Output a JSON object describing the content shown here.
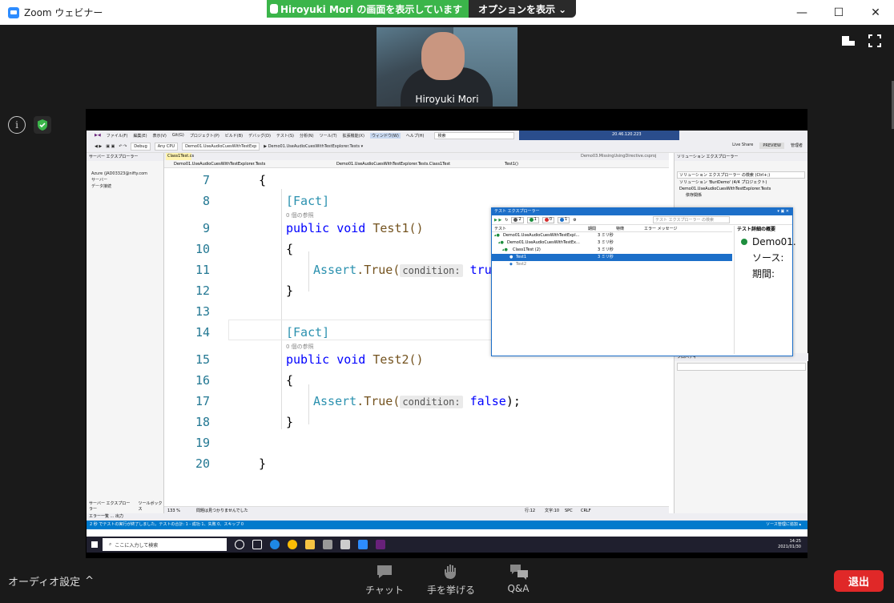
{
  "window": {
    "title": "Zoom ウェビナー",
    "minimize": "—",
    "maximize": "☐",
    "close": "✕"
  },
  "share_banner": {
    "text": "Hiroyuki  Mori の画面を表示しています",
    "options": "オプションを表示 ⌄"
  },
  "video": {
    "participant_name": "Hiroyuki Mori"
  },
  "vs": {
    "menu": [
      "ファイル(F)",
      "編集(E)",
      "表示(V)",
      "Git(G)",
      "プロジェクト(P)",
      "ビルド(B)",
      "デバッグ(D)",
      "テスト(S)",
      "分析(N)",
      "ツール(T)",
      "拡張機能(X)"
    ],
    "menu_highlight": "ウィンドウ(W)",
    "menu_help": "ヘルプ(H)",
    "search": "検索",
    "remote_ip": "20.46.120.223",
    "toolbar": {
      "config": "Debug",
      "platform": "Any CPU",
      "project": "Demo01.UseAudioCuesWithTestExp",
      "run_target": "▶ Demo01.UseAudioCuesWithTestExplorer.Tests ▾",
      "live_share": "Live Share",
      "preview": "PREVIEW",
      "admin": "管理者"
    },
    "server_explorer": {
      "title": "サーバー エクスプローラー",
      "items": [
        "Azure (JAD03323@nifty.com",
        "サーバー",
        "データ接続"
      ],
      "footer": [
        "サーバー エクスプローラー",
        "ツールボックス"
      ]
    },
    "editor": {
      "tab": "Class1Test.cs",
      "tab2": "Demo03.MissingUsingDirective.csproj",
      "nav_project": "Demo01.UseAudioCuesWithTestExplorer.Tests",
      "nav_class": "Demo01.UseAudioCuesWithTestExplorer.Tests.Class1Test",
      "nav_member": "Test1()",
      "refs": "0 個の参照",
      "param_hint": "condition:",
      "lines": [
        {
          "n": "7"
        },
        {
          "n": "8"
        },
        {
          "n": "9"
        },
        {
          "n": "10"
        },
        {
          "n": "11"
        },
        {
          "n": "12"
        },
        {
          "n": "13"
        },
        {
          "n": "14"
        },
        {
          "n": "15"
        },
        {
          "n": "16"
        },
        {
          "n": "17"
        },
        {
          "n": "18"
        },
        {
          "n": "19"
        },
        {
          "n": "20"
        }
      ],
      "code": {
        "open_brace": "{",
        "close_brace": "}",
        "attr": "[Fact]",
        "kw_public": "public",
        "kw_void": "void",
        "test1": "Test1()",
        "test2": "Test2()",
        "assert": "Assert",
        "true_call": ".True(",
        "val_true": "true",
        "val_false": "false",
        "end": ");"
      },
      "status": {
        "zoom": "133 %",
        "issues": "問題は見つかりませんでした",
        "position": "行:12",
        "char": "文字:10",
        "spc": "SPC",
        "crlf": "CRLF"
      }
    },
    "output_tabs": "エラー一覧 ... 出力",
    "statusbar": "2 秒 でテストの実行が終了しました。テストの合計: 1 - 成功 1、失敗 0、スキップ 0",
    "statusbar_right": "ソース管理に追加 ▴",
    "solution": {
      "title": "ソリューション エクスプローラー",
      "search": "ソリューション エクスプローラー の検索 (Ctrl+;)",
      "items": [
        "ソリューション 'BuriDemo' (4/4 プロジェクト)",
        "Demo01.UseAudioCuesWithTestExplorer.Tests",
        "依存関係"
      ],
      "properties": "プロパティ"
    },
    "test_explorer": {
      "title": "テスト エクスプローラー",
      "counts": {
        "total": "2",
        "passed": "1",
        "failed": "0",
        "info": "1"
      },
      "search": "テスト エクスプローラー の検索",
      "headers": [
        "テスト",
        "期間",
        "特徴",
        "エラー メッセージ"
      ],
      "rows": [
        {
          "name": "Demo01.UseAudioCuesWithTestExpl...",
          "dur": "3 ミリ秒"
        },
        {
          "name": "Demo01.UseAudioCuesWithTestEx...",
          "dur": "3 ミリ秒"
        },
        {
          "name": "Class1Test (2)",
          "dur": "3 ミリ秒"
        },
        {
          "name": "Test1",
          "dur": "3 ミリ秒"
        },
        {
          "name": "Test2",
          "dur": ""
        }
      ],
      "detail_title": "テスト詳細の概要",
      "detail_name": "Demo01.",
      "detail_source": "ソース:",
      "detail_duration": "期間:"
    }
  },
  "taskbar": {
    "search": "ここに入力して検索",
    "time": "14:25",
    "date": "2021/01/30"
  },
  "bottom": {
    "audio": "オーディオ設定",
    "chat": "チャット",
    "raise_hand": "手を挙げる",
    "qa": "Q&A",
    "leave": "退出"
  },
  "colors": {
    "zoom_blue": "#2d8cff",
    "share_green": "#3bb54a",
    "leave_red": "#e02828",
    "vs_blue": "#007acc"
  }
}
